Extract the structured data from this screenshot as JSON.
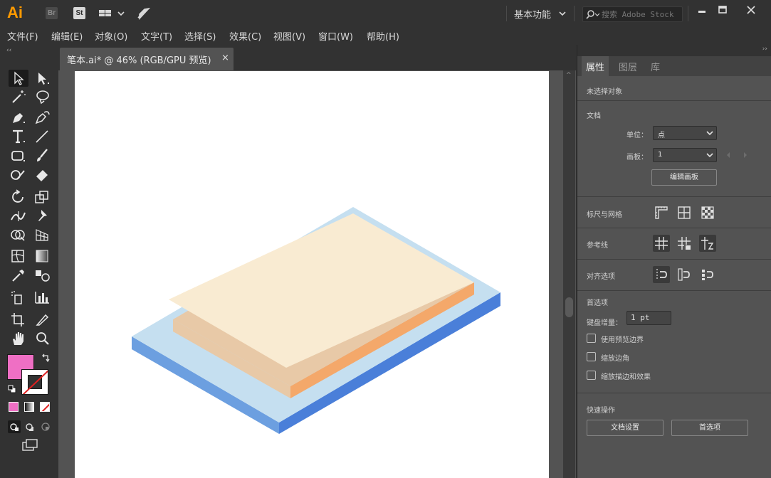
{
  "app": {
    "logo": "Ai",
    "bridge_label": "Br",
    "stock_label": "St",
    "workspace": "基本功能",
    "search": {
      "placeholder": "搜索 Adobe Stock"
    }
  },
  "menu": [
    "文件(F)",
    "编辑(E)",
    "对象(O)",
    "文字(T)",
    "选择(S)",
    "效果(C)",
    "视图(V)",
    "窗口(W)",
    "帮助(H)"
  ],
  "document": {
    "tab_title": "笔本.ai* @ 46% (RGB/GPU 预览)",
    "close_glyph": "×"
  },
  "colors": {
    "fill": "#ef6fc4",
    "accent": "#ff9a00",
    "base_top": "#c5dff0",
    "base_left": "#6c9fe0",
    "base_right": "#4a7fd9",
    "paper_top": "#f9ebd2",
    "paper_left": "#e8c9a7",
    "paper_right": "#f4a86a"
  },
  "panel": {
    "tabs": [
      "属性",
      "图层",
      "库"
    ],
    "no_selection": "未选择对象",
    "document_section": "文档",
    "unit_label": "单位：",
    "unit_value": "点",
    "artboard_label": "画板：",
    "artboard_value": "1",
    "edit_artboard_button": "编辑画板",
    "rulers_grids": "标尺与网格",
    "guides": "参考线",
    "align_options": "对齐选项",
    "preferences_section": "首选项",
    "keyboard_increment_label": "键盘增量：",
    "keyboard_increment_value": "1 pt",
    "checkboxes": [
      "使用预览边界",
      "缩放边角",
      "缩放描边和效果"
    ],
    "quick_actions": "快速操作",
    "doc_settings_button": "文档设置",
    "preferences_button": "首选项"
  }
}
